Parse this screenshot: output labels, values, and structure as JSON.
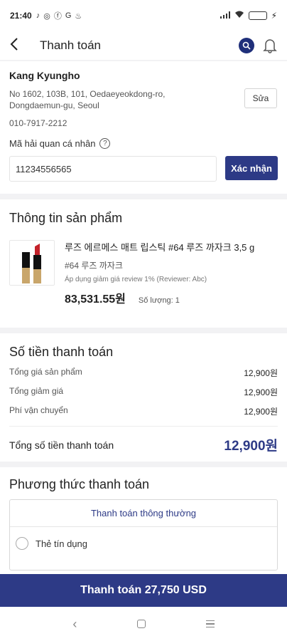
{
  "status_bar": {
    "time": "21:40",
    "icons": [
      "tiktok-icon",
      "whatsapp-icon",
      "facebook-icon",
      "google-icon",
      "notification-icon"
    ]
  },
  "app_bar": {
    "title": "Thanh toán"
  },
  "address": {
    "name": "Kang Kyungho",
    "line": "No 1602, 103B, 101, Oedaeyeokdong-ro, Dongdaemun-gu, Seoul",
    "phone": "010-7917-2212",
    "edit_label": "Sửa",
    "customs_label": "Mã hải quan cá nhân",
    "customs_value": "11234556565",
    "confirm_label": "Xác nhận"
  },
  "product": {
    "section_title": "Thông tin sản phẩm",
    "name": "루즈 에르메스 매트 립스틱 #64 루즈 까자크 3,5 g",
    "variant": "#64 루즈 까자크",
    "discount_note": "Áp dụng giảm giá review 1% (Reviewer: Abc)",
    "price": "83,531.55원",
    "quantity": "Số lượng: 1"
  },
  "amount": {
    "section_title": "Số tiền thanh toán",
    "lines": [
      {
        "label": "Tổng giá sản phẩm",
        "value": "12,900원"
      },
      {
        "label": "Tổng giảm giá",
        "value": "12,900원"
      },
      {
        "label": "Phí vận chuyển",
        "value": "12,900원"
      }
    ],
    "total_label": "Tổng số tiền thanh toán",
    "total_value": "12,900원"
  },
  "payment": {
    "section_title": "Phương thức thanh toán",
    "tab_label": "Thanh toán thông thường",
    "option_label": "Thẻ tín dụng"
  },
  "pay_button": {
    "label": "Thanh toán 27,750 USD"
  },
  "colors": {
    "accent": "#2d3a86",
    "background": "#f2f2f4"
  }
}
